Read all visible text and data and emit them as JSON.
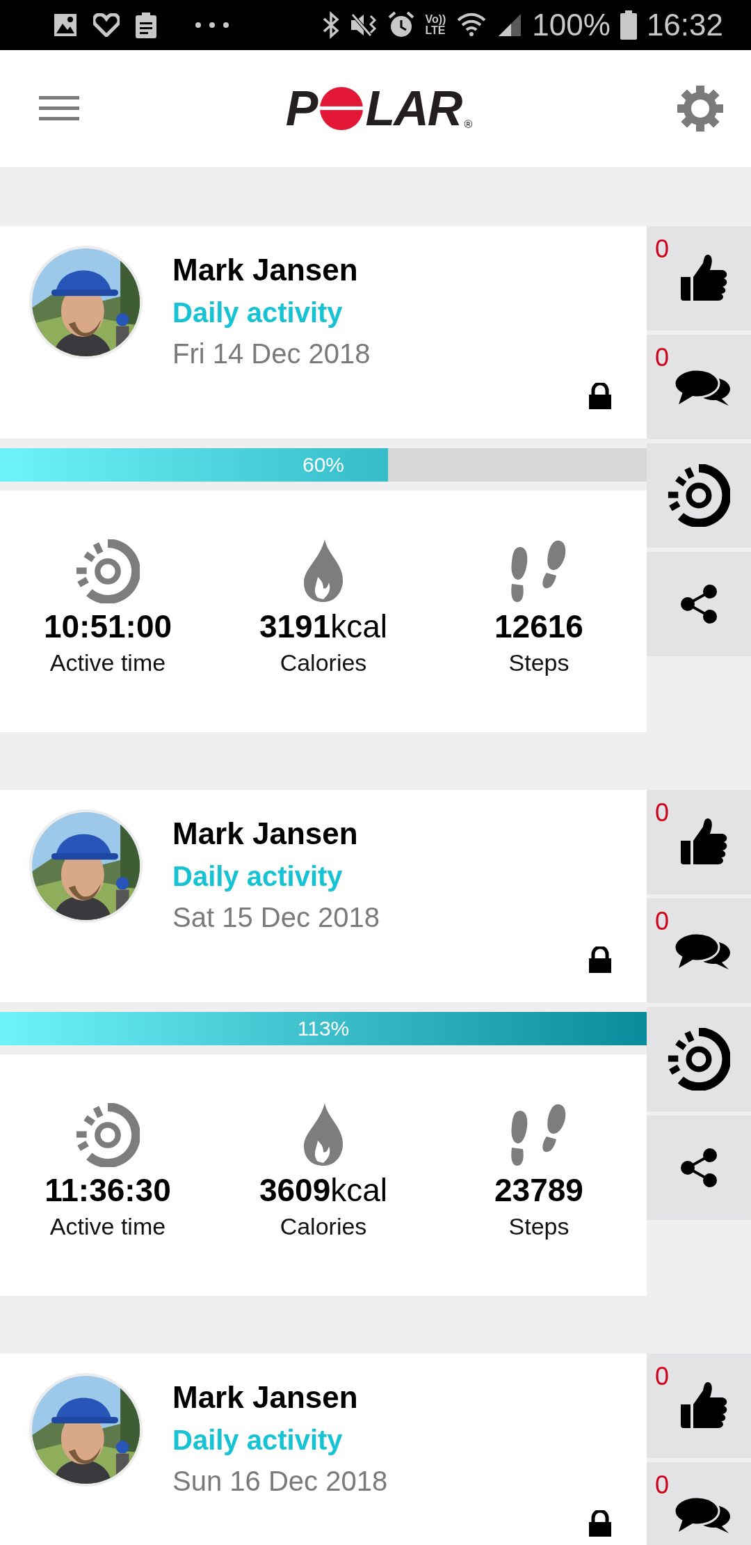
{
  "status_bar": {
    "volte": [
      "Vo))",
      "LTE"
    ],
    "battery": "100%",
    "time": "16:32"
  },
  "header": {
    "logo": {
      "before": "P",
      "after": "LAR",
      "mark": "®"
    }
  },
  "cards": [
    {
      "name": "Mark Jansen",
      "activity": "Daily activity",
      "date": "Fri 14 Dec 2018",
      "private": true,
      "likes": "0",
      "comments": "0",
      "progress": {
        "level": 0.6,
        "label": "60%"
      },
      "stats": [
        {
          "kind": "time",
          "value": "10:51:00",
          "label": "Active time"
        },
        {
          "kind": "calories",
          "value": "3191",
          "unit": "kcal",
          "label": "Calories"
        },
        {
          "kind": "steps",
          "value": "12616",
          "label": "Steps"
        }
      ]
    },
    {
      "name": "Mark Jansen",
      "activity": "Daily activity",
      "date": "Sat 15 Dec 2018",
      "private": true,
      "likes": "0",
      "comments": "0",
      "progress": {
        "level": 1,
        "label": "113%"
      },
      "stats": [
        {
          "kind": "time",
          "value": "11:36:30",
          "label": "Active time"
        },
        {
          "kind": "calories",
          "value": "3609",
          "unit": "kcal",
          "label": "Calories"
        },
        {
          "kind": "steps",
          "value": "23789",
          "label": "Steps"
        }
      ]
    },
    {
      "name": "Mark Jansen",
      "activity": "Daily activity",
      "date": "Sun 16 Dec 2018",
      "private": true,
      "likes": "0",
      "comments": "0"
    }
  ]
}
